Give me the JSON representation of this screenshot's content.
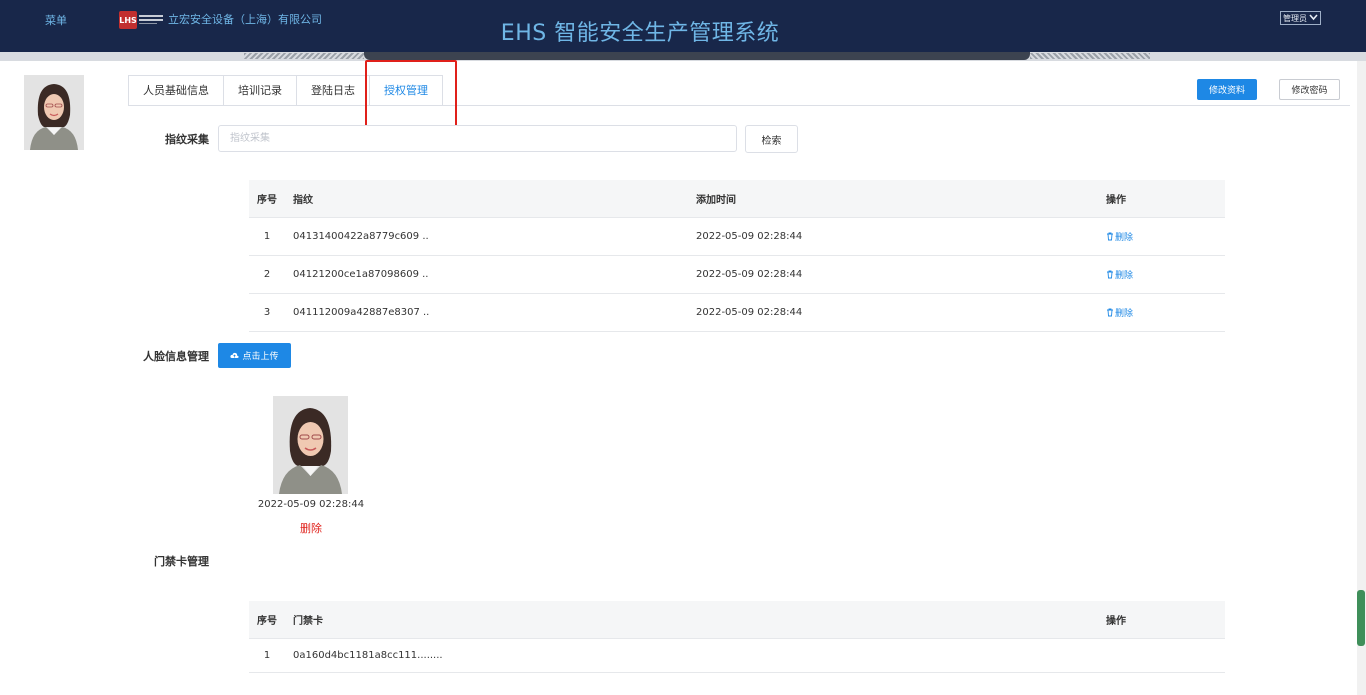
{
  "header": {
    "menu_label": "菜单",
    "company_name": "立宏安全设备（上海）有限公司",
    "system_title": "EHS 智能安全生产管理系统",
    "user_role": "管理员"
  },
  "tabs": [
    {
      "label": "人员基础信息"
    },
    {
      "label": "培训记录"
    },
    {
      "label": "登陆日志"
    },
    {
      "label": "授权管理"
    }
  ],
  "actions": {
    "edit_profile": "修改资料",
    "change_password": "修改密码"
  },
  "fingerprint": {
    "label": "指纹采集",
    "placeholder": "指纹采集",
    "search_label": "检索",
    "columns": {
      "no": "序号",
      "fingerprint": "指纹",
      "added": "添加时间",
      "op": "操作"
    },
    "rows": [
      {
        "no": "1",
        "fingerprint": "04131400422a8779c609 ..",
        "added": "2022-05-09 02:28:44",
        "op": "删除"
      },
      {
        "no": "2",
        "fingerprint": "04121200ce1a87098609 ..",
        "added": "2022-05-09 02:28:44",
        "op": "删除"
      },
      {
        "no": "3",
        "fingerprint": "041112009a42887e8307 ..",
        "added": "2022-05-09 02:28:44",
        "op": "删除"
      }
    ]
  },
  "face": {
    "label": "人脸信息管理",
    "upload_label": "点击上传",
    "time": "2022-05-09 02:28:44",
    "delete_label": "删除"
  },
  "access_card": {
    "label": "门禁卡管理",
    "columns": {
      "no": "序号",
      "card": "门禁卡",
      "op": "操作"
    },
    "rows": [
      {
        "no": "1",
        "card": "0a160d4bc1181a8cc111........",
        "op": ""
      }
    ]
  },
  "colors": {
    "header_bg": "#18274a",
    "accent": "#1e88e5",
    "danger": "#e0201a",
    "title": "#6fb6e6"
  }
}
